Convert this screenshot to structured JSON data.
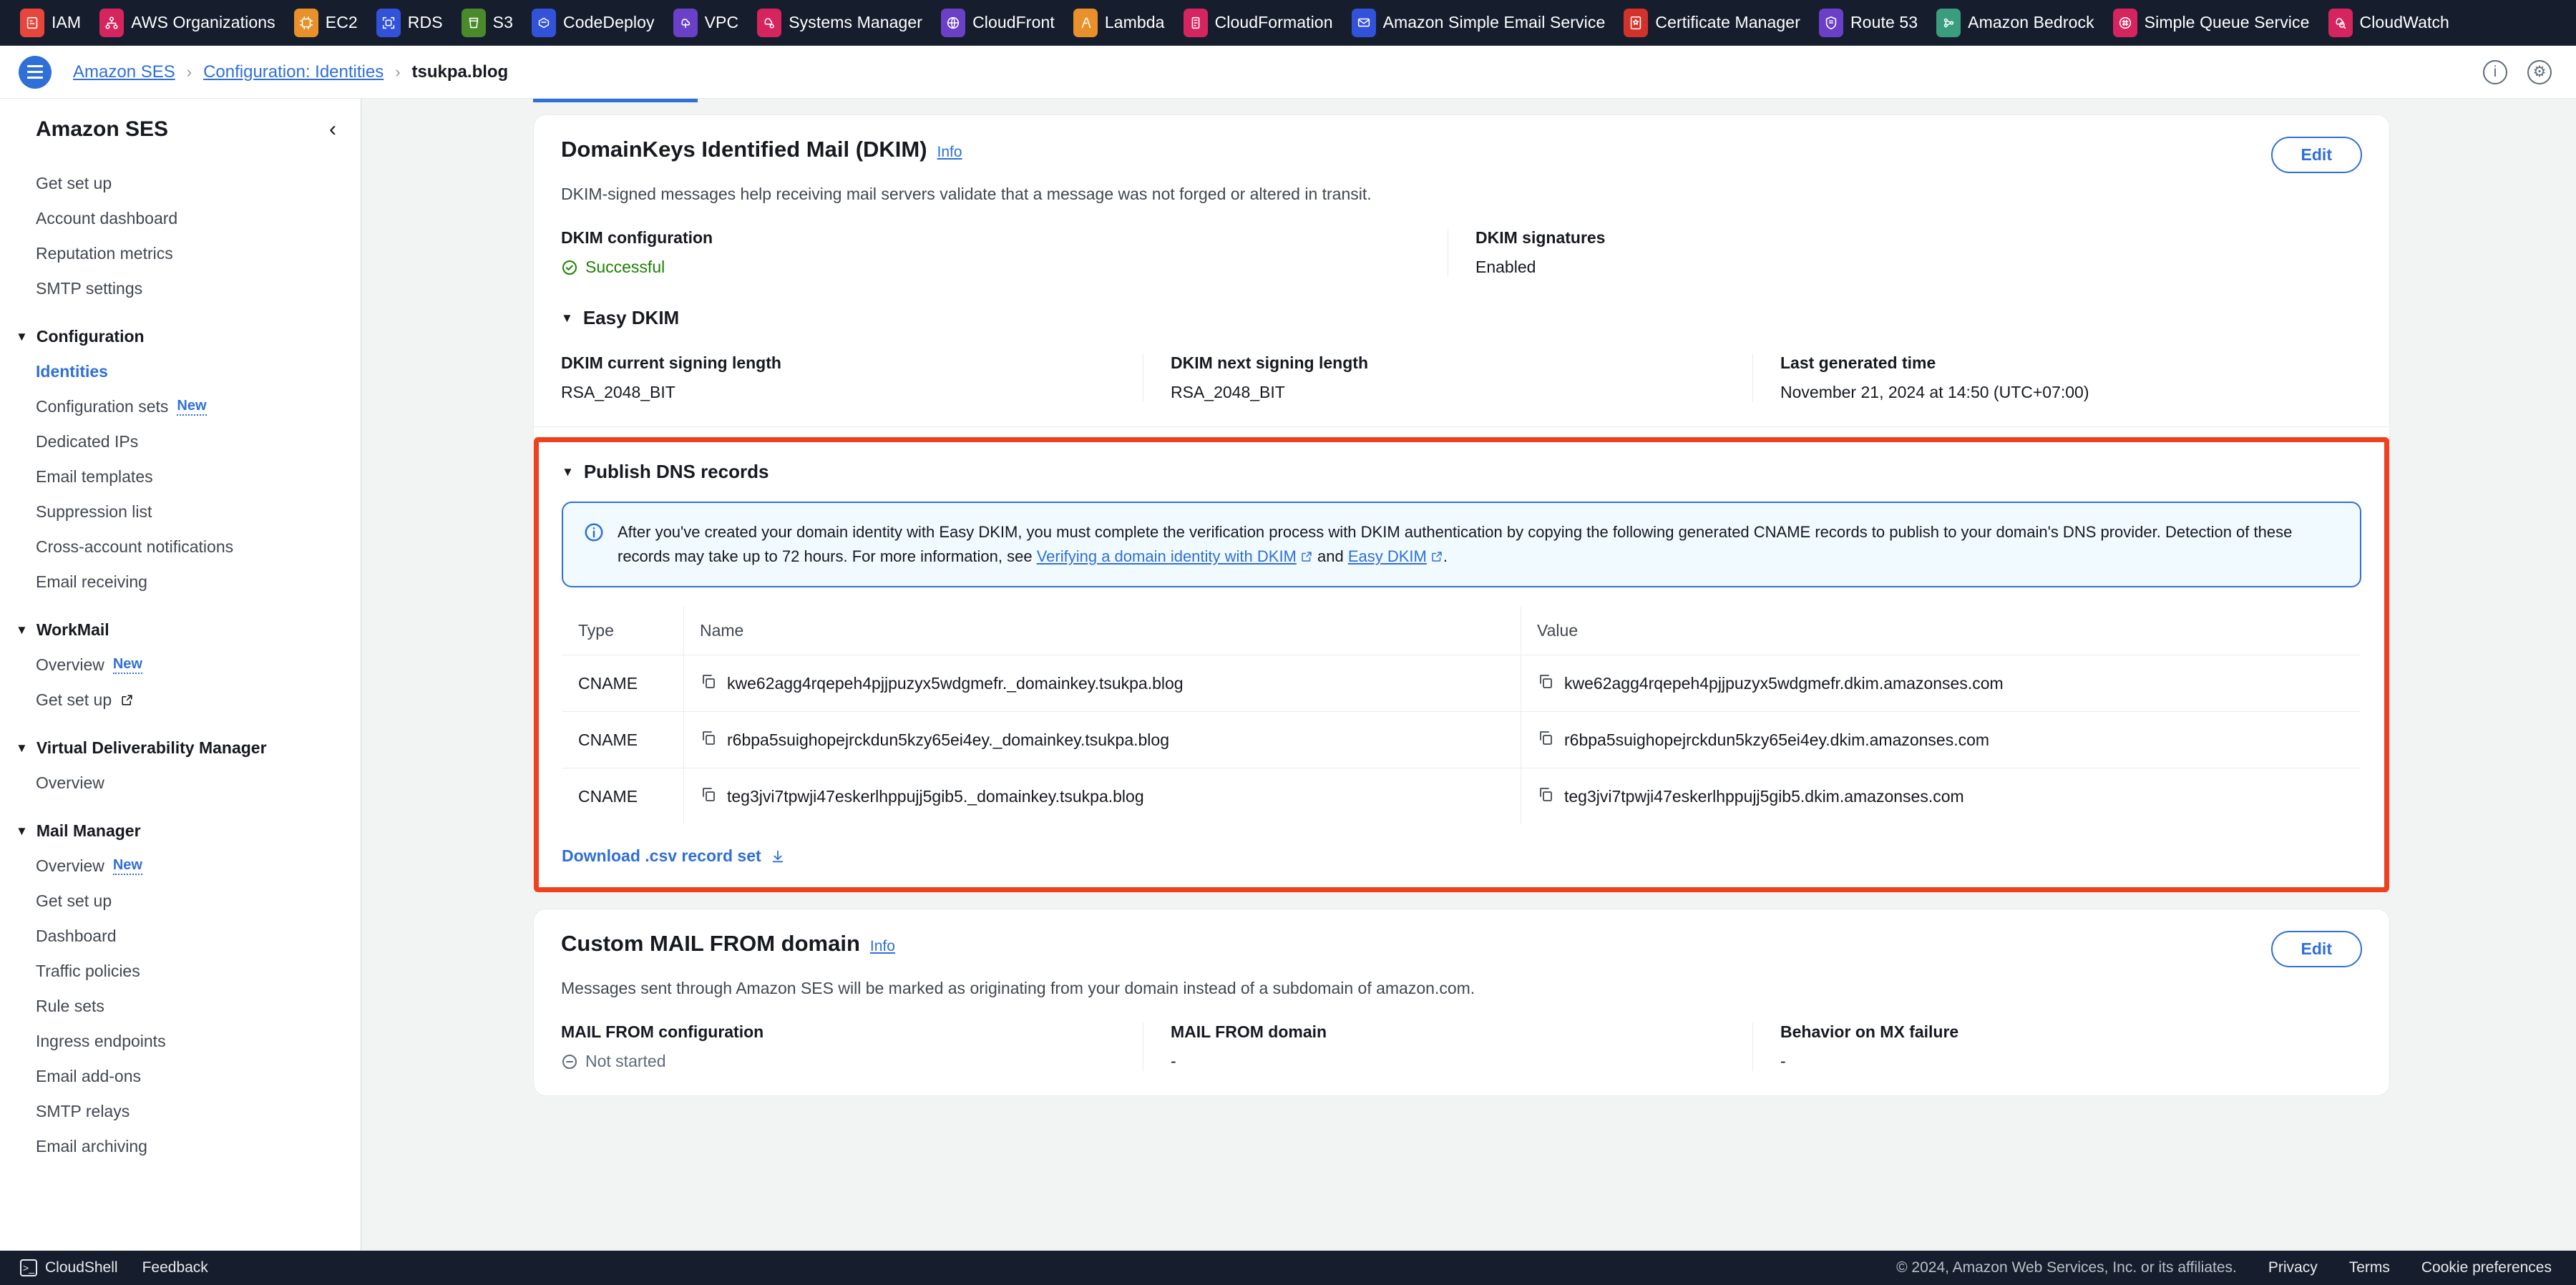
{
  "service_bar": {
    "services": [
      {
        "label": "IAM",
        "icon": "iam-icon",
        "color": "#e8453c"
      },
      {
        "label": "AWS Organizations",
        "icon": "organizations-icon",
        "color": "#d6245e"
      },
      {
        "label": "EC2",
        "icon": "ec2-icon",
        "color": "#e8912a"
      },
      {
        "label": "RDS",
        "icon": "rds-icon",
        "color": "#3252d9"
      },
      {
        "label": "S3",
        "icon": "s3-icon",
        "color": "#4a8a2b"
      },
      {
        "label": "CodeDeploy",
        "icon": "codedeploy-icon",
        "color": "#3252d9"
      },
      {
        "label": "VPC",
        "icon": "vpc-icon",
        "color": "#6a40c9"
      },
      {
        "label": "Systems Manager",
        "icon": "systems-manager-icon",
        "color": "#d6245e"
      },
      {
        "label": "CloudFront",
        "icon": "cloudfront-icon",
        "color": "#6a40c9"
      },
      {
        "label": "Lambda",
        "icon": "lambda-icon",
        "color": "#e8912a"
      },
      {
        "label": "CloudFormation",
        "icon": "cloudformation-icon",
        "color": "#d6245e"
      },
      {
        "label": "Amazon Simple Email Service",
        "icon": "ses-icon",
        "color": "#3252d9"
      },
      {
        "label": "Certificate Manager",
        "icon": "certificate-manager-icon",
        "color": "#d3322b"
      },
      {
        "label": "Route 53",
        "icon": "route53-icon",
        "color": "#6a40c9"
      },
      {
        "label": "Amazon Bedrock",
        "icon": "bedrock-icon",
        "color": "#3a9d7e"
      },
      {
        "label": "Simple Queue Service",
        "icon": "sqs-icon",
        "color": "#d6245e"
      },
      {
        "label": "CloudWatch",
        "icon": "cloudwatch-icon",
        "color": "#d6245e"
      }
    ]
  },
  "breadcrumb": {
    "items": [
      {
        "label": "Amazon SES",
        "current": false
      },
      {
        "label": "Configuration: Identities",
        "current": false
      },
      {
        "label": "tsukpa.blog",
        "current": true
      }
    ],
    "separator": "›"
  },
  "sidebar": {
    "title": "Amazon SES",
    "collapse_icon": "‹",
    "items": [
      {
        "label": "Get set up",
        "type": "link"
      },
      {
        "label": "Account dashboard",
        "type": "link"
      },
      {
        "label": "Reputation metrics",
        "type": "link"
      },
      {
        "label": "SMTP settings",
        "type": "link"
      },
      {
        "label": "Configuration",
        "type": "group"
      },
      {
        "label": "Identities",
        "type": "link",
        "active": true
      },
      {
        "label": "Configuration sets",
        "type": "link",
        "badge": "New"
      },
      {
        "label": "Dedicated IPs",
        "type": "link"
      },
      {
        "label": "Email templates",
        "type": "link"
      },
      {
        "label": "Suppression list",
        "type": "link"
      },
      {
        "label": "Cross-account notifications",
        "type": "link"
      },
      {
        "label": "Email receiving",
        "type": "link"
      },
      {
        "label": "WorkMail",
        "type": "group"
      },
      {
        "label": "Overview",
        "type": "link",
        "badge": "New"
      },
      {
        "label": "Get set up",
        "type": "link",
        "external": true
      },
      {
        "label": "Virtual Deliverability Manager",
        "type": "group"
      },
      {
        "label": "Overview",
        "type": "link"
      },
      {
        "label": "Mail Manager",
        "type": "group"
      },
      {
        "label": "Overview",
        "type": "link",
        "badge": "New"
      },
      {
        "label": "Get set up",
        "type": "link"
      },
      {
        "label": "Dashboard",
        "type": "link"
      },
      {
        "label": "Traffic policies",
        "type": "link"
      },
      {
        "label": "Rule sets",
        "type": "link"
      },
      {
        "label": "Ingress endpoints",
        "type": "link"
      },
      {
        "label": "Email add-ons",
        "type": "link"
      },
      {
        "label": "SMTP relays",
        "type": "link"
      },
      {
        "label": "Email archiving",
        "type": "link"
      }
    ]
  },
  "dkim_card": {
    "title": "DomainKeys Identified Mail (DKIM)",
    "info_label": "Info",
    "edit_label": "Edit",
    "description": "DKIM-signed messages help receiving mail servers validate that a message was not forged or altered in transit.",
    "config_label": "DKIM configuration",
    "config_value": "Successful",
    "signatures_label": "DKIM signatures",
    "signatures_value": "Enabled",
    "easy_dkim_label": "Easy DKIM",
    "current_length_label": "DKIM current signing length",
    "current_length_value": "RSA_2048_BIT",
    "next_length_label": "DKIM next signing length",
    "next_length_value": "RSA_2048_BIT",
    "last_generated_label": "Last generated time",
    "last_generated_value": "November 21, 2024 at 14:50 (UTC+07:00)"
  },
  "publish_dns": {
    "section_label": "Publish DNS records",
    "highlight_color": "#f0411f",
    "alert": {
      "text_part1": "After you've created your domain identity with Easy DKIM, you must complete the verification process with DKIM authentication by copying the following generated CNAME records to publish to your domain's DNS provider. Detection of these records may take up to 72 hours. For more information, see ",
      "link1": "Verifying a domain identity with DKIM",
      "conjunction": " and ",
      "link2": "Easy DKIM",
      "text_end": "."
    },
    "table": {
      "columns": [
        "Type",
        "Name",
        "Value"
      ],
      "rows": [
        {
          "type": "CNAME",
          "name": "kwe62agg4rqepeh4pjjpuzyx5wdgmefr._domainkey.tsukpa.blog",
          "value": "kwe62agg4rqepeh4pjjpuzyx5wdgmefr.dkim.amazonses.com"
        },
        {
          "type": "CNAME",
          "name": "r6bpa5suighopejrckdun5kzy65ei4ey._domainkey.tsukpa.blog",
          "value": "r6bpa5suighopejrckdun5kzy65ei4ey.dkim.amazonses.com"
        },
        {
          "type": "CNAME",
          "name": "teg3jvi7tpwji47eskerlhppujj5gib5._domainkey.tsukpa.blog",
          "value": "teg3jvi7tpwji47eskerlhppujj5gib5.dkim.amazonses.com"
        }
      ]
    },
    "download_label": "Download .csv record set"
  },
  "mail_from_card": {
    "title": "Custom MAIL FROM domain",
    "info_label": "Info",
    "edit_label": "Edit",
    "description": "Messages sent through Amazon SES will be marked as originating from your domain instead of a subdomain of amazon.com.",
    "config_label": "MAIL FROM configuration",
    "config_value": "Not started",
    "domain_label": "MAIL FROM domain",
    "domain_value": "-",
    "behavior_label": "Behavior on MX failure",
    "behavior_value": "-"
  },
  "footer": {
    "cloudshell_label": "CloudShell",
    "feedback_label": "Feedback",
    "copyright": "© 2024, Amazon Web Services, Inc. or its affiliates.",
    "privacy_label": "Privacy",
    "terms_label": "Terms",
    "cookie_label": "Cookie preferences"
  }
}
